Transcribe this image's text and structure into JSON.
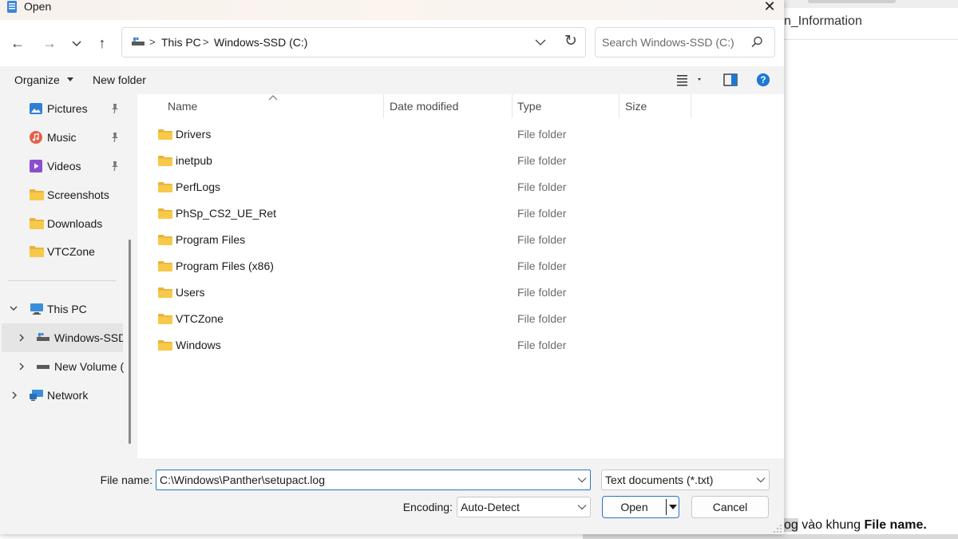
{
  "background_app": {
    "field_text": "n_Information",
    "caption_highlight": "og",
    "caption_middle": " vào khung ",
    "caption_bold": "File name."
  },
  "dialog": {
    "title": "Open",
    "address": {
      "crumbs": [
        "This PC",
        "Windows-SSD (C:)"
      ],
      "separator": ">"
    },
    "search": {
      "placeholder": "Search Windows-SSD (C:)"
    },
    "toolbar": {
      "organize_label": "Organize",
      "new_folder_label": "New folder"
    },
    "sidebar": {
      "quick_access": [
        {
          "label": "Pictures",
          "icon": "pictures-icon",
          "pinned": true
        },
        {
          "label": "Music",
          "icon": "music-icon",
          "pinned": true
        },
        {
          "label": "Videos",
          "icon": "videos-icon",
          "pinned": true
        },
        {
          "label": "Screenshots",
          "icon": "folder-icon",
          "pinned": false
        },
        {
          "label": "Downloads",
          "icon": "folder-icon",
          "pinned": false
        },
        {
          "label": "VTCZone",
          "icon": "folder-icon",
          "pinned": false
        }
      ],
      "tree": [
        {
          "label": "This PC",
          "icon": "this-pc-icon",
          "expanded": true
        },
        {
          "label": "Windows-SSD (C:)",
          "icon": "drive-icon",
          "selected": true
        },
        {
          "label": "New Volume (D:)",
          "icon": "volume-icon"
        },
        {
          "label": "Network",
          "icon": "network-icon"
        }
      ]
    },
    "columns": [
      "Name",
      "Date modified",
      "Type",
      "Size"
    ],
    "files": [
      {
        "name": "Drivers",
        "date": "",
        "type": "File folder",
        "size": ""
      },
      {
        "name": "inetpub",
        "date": "",
        "type": "File folder",
        "size": ""
      },
      {
        "name": "PerfLogs",
        "date": "",
        "type": "File folder",
        "size": ""
      },
      {
        "name": "PhSp_CS2_UE_Ret",
        "date": "",
        "type": "File folder",
        "size": ""
      },
      {
        "name": "Program Files",
        "date": "",
        "type": "File folder",
        "size": ""
      },
      {
        "name": "Program Files (x86)",
        "date": "",
        "type": "File folder",
        "size": ""
      },
      {
        "name": "Users",
        "date": "",
        "type": "File folder",
        "size": ""
      },
      {
        "name": "VTCZone",
        "date": "",
        "type": "File folder",
        "size": ""
      },
      {
        "name": "Windows",
        "date": "",
        "type": "File folder",
        "size": ""
      }
    ],
    "bottom": {
      "file_name_label": "File name:",
      "file_name_value": "C:\\Windows\\Panther\\setupact.log",
      "file_type_value": "Text documents (*.txt)",
      "encoding_label": "Encoding:",
      "encoding_value": "Auto-Detect",
      "open_label": "Open",
      "cancel_label": "Cancel"
    }
  },
  "colors": {
    "accent": "#2b73c8",
    "folder": "#f7c94a",
    "help": "#1e78d6"
  }
}
